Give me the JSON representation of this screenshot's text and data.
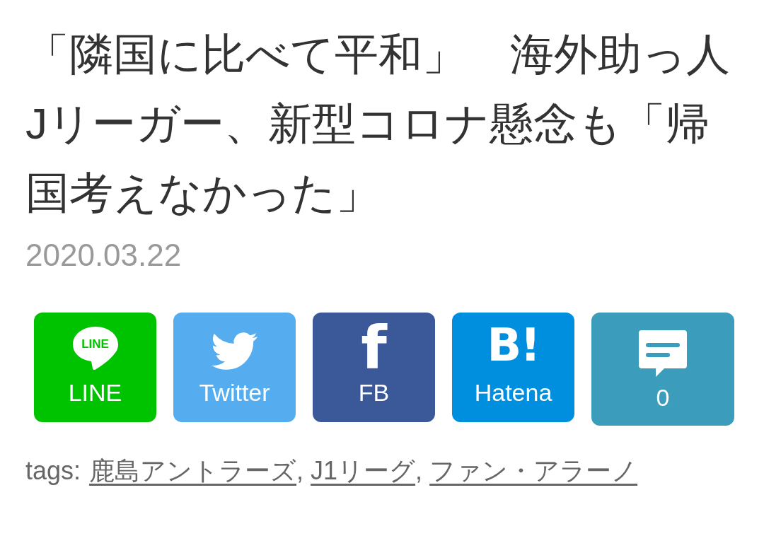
{
  "article": {
    "title": "「隣国に比べて平和」　海外助っ人Jリーガー、新型コロナ懸念も「帰国考えなかった」",
    "date": "2020.03.22"
  },
  "share_buttons": [
    {
      "kind": "line",
      "label": "LINE",
      "icon_text": "LINE"
    },
    {
      "kind": "twitter",
      "label": "Twitter"
    },
    {
      "kind": "facebook",
      "label": "FB",
      "icon_text": "f"
    },
    {
      "kind": "hatena",
      "label": "Hatena",
      "icon_text": "B!"
    },
    {
      "kind": "comment",
      "label": "0"
    }
  ],
  "tags": {
    "label": "tags:",
    "separator": ",",
    "items": [
      {
        "label": "鹿島アントラーズ"
      },
      {
        "label": "J1リーグ"
      },
      {
        "label": "ファン・アラーノ"
      }
    ]
  }
}
